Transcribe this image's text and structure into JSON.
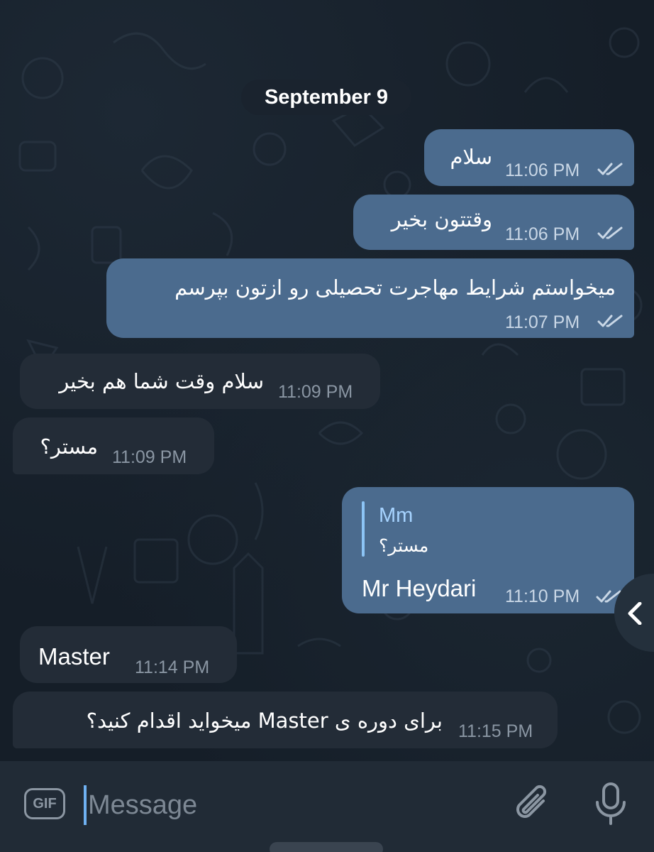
{
  "date_separator": "September 9",
  "messages": [
    {
      "direction": "outgoing",
      "text": "سلام",
      "time": "11:06 PM",
      "read": true
    },
    {
      "direction": "outgoing",
      "text": "وقتتون بخیر",
      "time": "11:06 PM",
      "read": true
    },
    {
      "direction": "outgoing",
      "text": "میخواستم شرایط مهاجرت تحصیلی رو ازتون بپرسم",
      "time": "11:07 PM",
      "read": true
    },
    {
      "direction": "incoming",
      "text": "سلام وقت شما هم بخیر",
      "time": "11:09 PM"
    },
    {
      "direction": "incoming",
      "text": "مستر؟",
      "time": "11:09 PM"
    },
    {
      "direction": "outgoing",
      "reply_to": {
        "name": "Mm",
        "text": "مستر؟"
      },
      "text": "Mr Heydari",
      "time": "11:10 PM",
      "read": true
    },
    {
      "direction": "incoming",
      "text": "Master",
      "time": "11:14 PM"
    },
    {
      "direction": "incoming",
      "text": "برای دوره ی Master میخواید اقدام کنید؟",
      "time": "11:15 PM"
    }
  ],
  "composer": {
    "gif_label": "GIF",
    "placeholder": "Message",
    "attach_icon": "paperclip-icon",
    "mic_icon": "microphone-icon"
  },
  "side_button_icon": "chevron-left-icon",
  "colors": {
    "background": "#151e28",
    "outgoing_bubble": "#4b6b8e",
    "incoming_bubble": "#232c37",
    "input_bar": "#212b36",
    "accent": "#6fb1f2"
  }
}
